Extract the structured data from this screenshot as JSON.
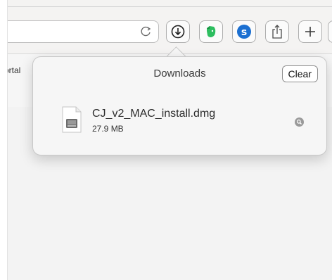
{
  "toolbar": {
    "buttons": [
      {
        "name": "downloads-button",
        "icon": "download-arrow-icon"
      },
      {
        "name": "evernote-button",
        "icon": "evernote-elephant-icon",
        "color": "#2dbe60"
      },
      {
        "name": "extension-s-button",
        "icon": "s-circle-icon",
        "color": "#1b6fd1"
      },
      {
        "name": "share-button",
        "icon": "share-icon"
      },
      {
        "name": "new-tab-button",
        "icon": "plus-icon"
      }
    ]
  },
  "bookmarks": {
    "item_partial": "ortal"
  },
  "downloads_popover": {
    "title": "Downloads",
    "clear_label": "Clear",
    "items": [
      {
        "filename": "CJ_v2_MAC_install.dmg",
        "size": "27.9 MB",
        "icon": "disk-image-file-icon"
      }
    ]
  }
}
